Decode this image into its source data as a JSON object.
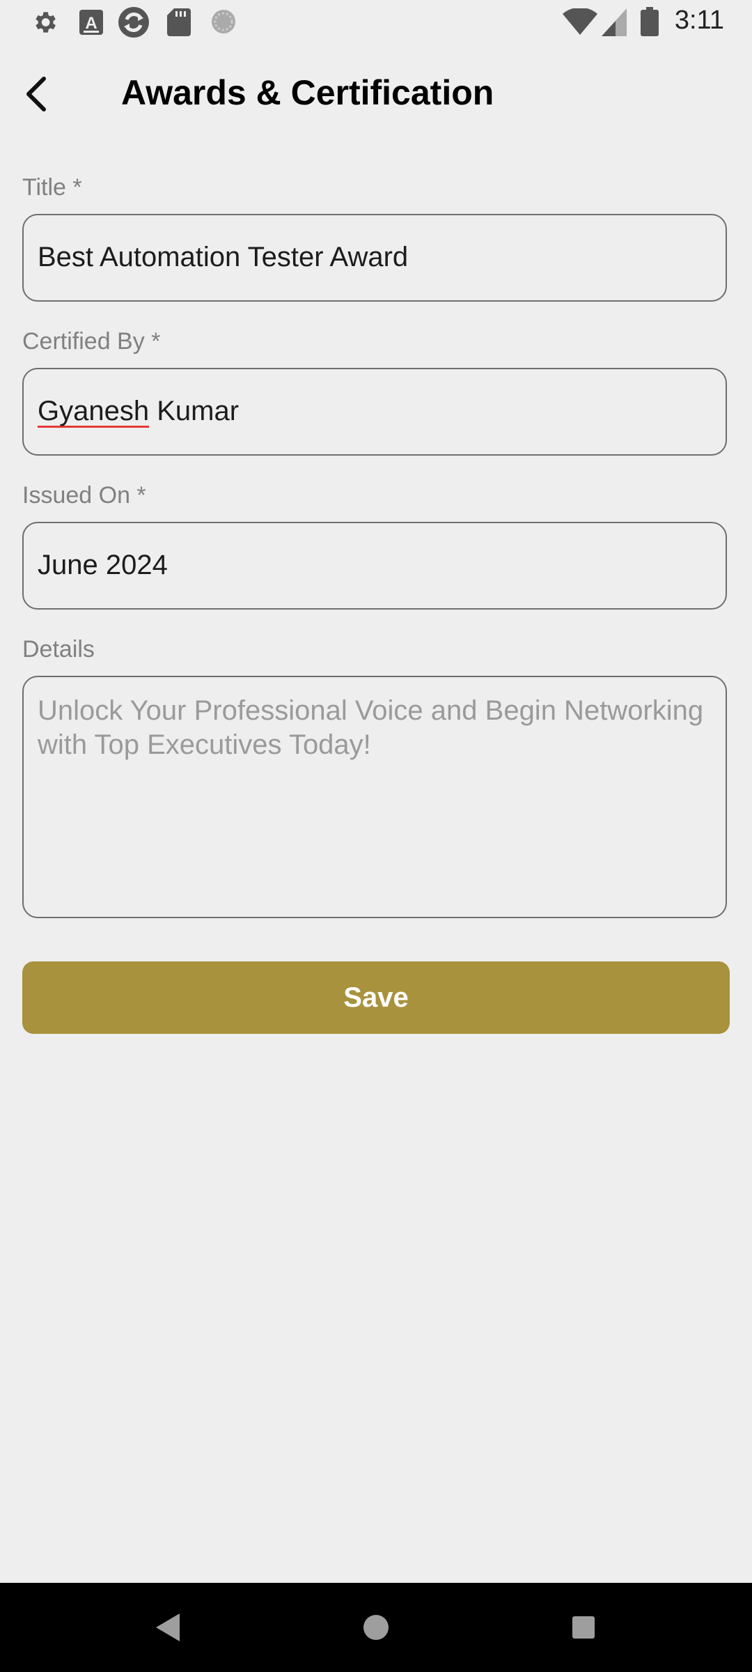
{
  "status_bar": {
    "time": "3:11",
    "left_icons": [
      "settings-icon",
      "a-app-icon",
      "sync-icon",
      "sd-card-icon",
      "loading-icon"
    ],
    "right_icons": [
      "wifi-icon",
      "signal-icon",
      "battery-icon"
    ]
  },
  "app_bar": {
    "title": "Awards & Certification",
    "back_icon": "arrow-back-icon"
  },
  "form": {
    "title": {
      "label": "Title *",
      "value": "Best Automation Tester Award"
    },
    "certified_by": {
      "label": "Certified By *",
      "value_first": "Gyanesh",
      "value_rest": " Kumar"
    },
    "issued_on": {
      "label": "Issued On *",
      "value": "June 2024"
    },
    "details": {
      "label": "Details",
      "placeholder": "Unlock Your Professional Voice and Begin Networking with Top Executives Today!"
    },
    "save_label": "Save"
  },
  "colors": {
    "background": "#eeeeee",
    "accent": "#a8923d",
    "spellcheck_underline": "#e53935"
  },
  "nav_bar": {
    "icons": [
      "nav-back-icon",
      "nav-home-icon",
      "nav-recents-icon"
    ]
  }
}
